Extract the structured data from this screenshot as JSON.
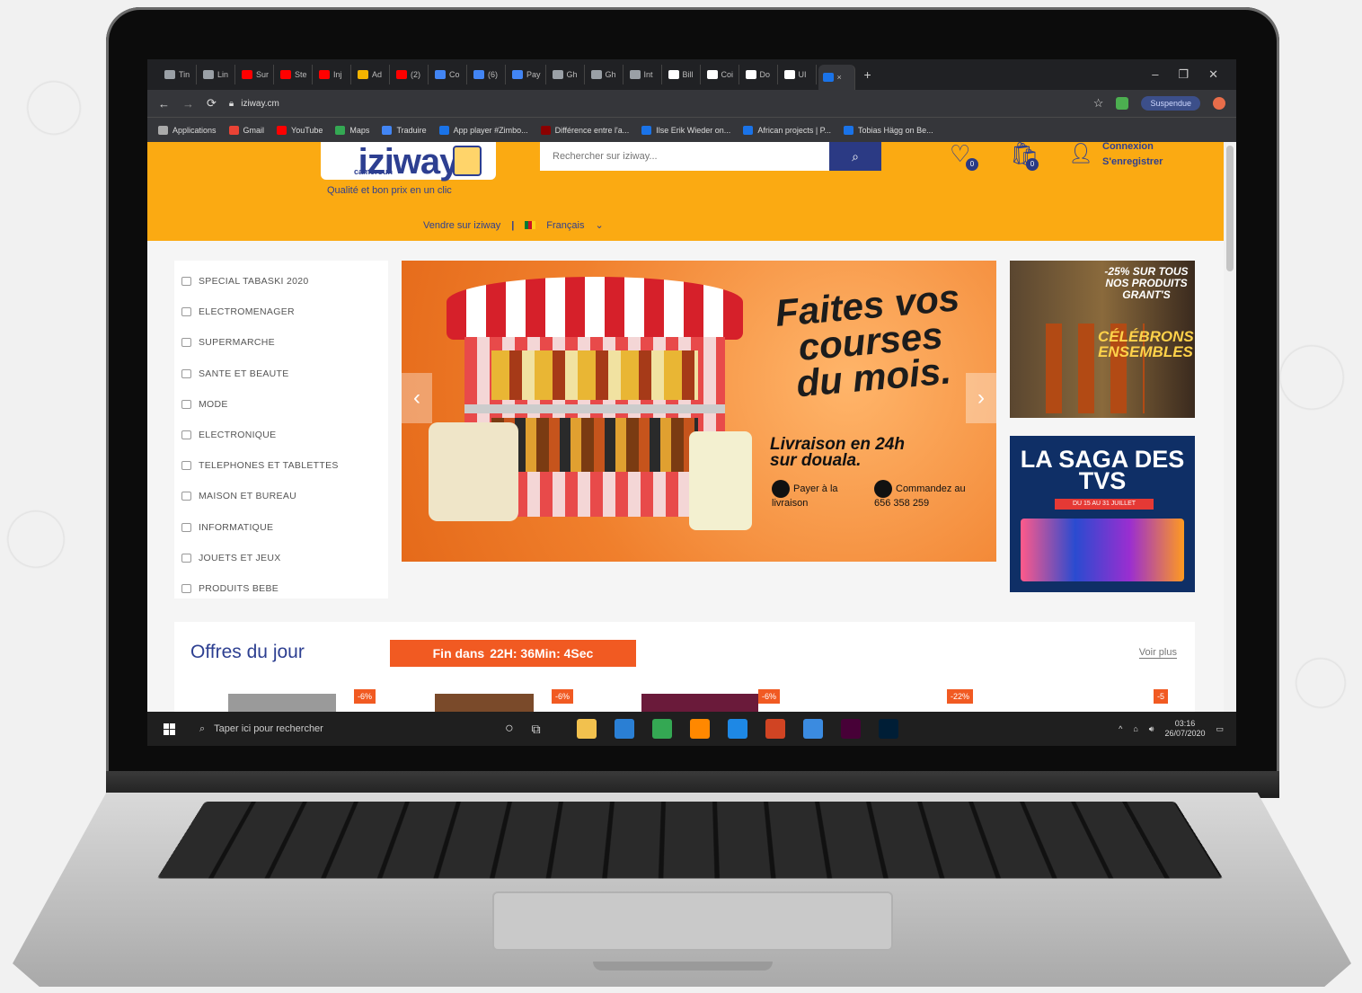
{
  "browser": {
    "tabs": [
      {
        "label": "Tin",
        "color": "#9aa0a6"
      },
      {
        "label": "Lin",
        "color": "#9aa0a6"
      },
      {
        "label": "Sur",
        "color": "#ff0000"
      },
      {
        "label": "Ste",
        "color": "#ff0000"
      },
      {
        "label": "Inj",
        "color": "#ff0000"
      },
      {
        "label": "Ad",
        "color": "#f4b400"
      },
      {
        "label": "(2)",
        "color": "#ff0000"
      },
      {
        "label": "Co",
        "color": "#4285f4"
      },
      {
        "label": "(6)",
        "color": "#4285f4"
      },
      {
        "label": "Pay",
        "color": "#4285f4"
      },
      {
        "label": "Gh",
        "color": "#9aa0a6"
      },
      {
        "label": "Gh",
        "color": "#9aa0a6"
      },
      {
        "label": "Int",
        "color": "#9aa0a6"
      },
      {
        "label": "Bill",
        "color": "#ffffff"
      },
      {
        "label": "Coi",
        "color": "#ffffff"
      },
      {
        "label": "Do",
        "color": "#ffffff"
      },
      {
        "label": "UI",
        "color": "#ffffff"
      }
    ],
    "active_tab_close": "×",
    "new_tab": "+",
    "window_controls": {
      "minimize": "–",
      "maximize": "❐",
      "close": "✕"
    },
    "url": "iziway.cm",
    "profile_button": "Suspendue",
    "bookmarks": [
      {
        "label": "Applications",
        "color": "#aaaaaa"
      },
      {
        "label": "Gmail",
        "color": "#ea4335"
      },
      {
        "label": "YouTube",
        "color": "#ff0000"
      },
      {
        "label": "Maps",
        "color": "#34a853"
      },
      {
        "label": "Traduire",
        "color": "#4285f4"
      },
      {
        "label": "App player #Zimbo...",
        "color": "#1a73e8"
      },
      {
        "label": "Différence entre l'a...",
        "color": "#8b0000"
      },
      {
        "label": "Ilse Erik Wieder on...",
        "color": "#1a73e8"
      },
      {
        "label": "African projects | P...",
        "color": "#1a73e8"
      },
      {
        "label": "Tobias Hägg on Be...",
        "color": "#1a73e8"
      }
    ]
  },
  "site": {
    "logo_text": "iziway",
    "logo_sub": "cameroun",
    "slogan": "Qualité et bon prix en un clic",
    "search_placeholder": "Rechercher sur iziway...",
    "wishlist_count": "0",
    "cart_count": "0",
    "login": "Connexion",
    "register": "S'enregistrer",
    "sell_link": "Vendre sur iziway",
    "language": "Français",
    "language_chevron": "⌄"
  },
  "categories": [
    "SPECIAL TABASKI 2020",
    "ELECTROMENAGER",
    "SUPERMARCHE",
    "SANTE ET BEAUTE",
    "MODE",
    "ELECTRONIQUE",
    "TELEPHONES ET TABLETTES",
    "MAISON ET BUREAU",
    "INFORMATIQUE",
    "JOUETS ET JEUX",
    "PRODUITS BEBE"
  ],
  "banner": {
    "title": "Faites vos courses du mois.",
    "subtitle_line1": "Livraison en 24h",
    "subtitle_line2": "sur douala.",
    "pay_label": "Payer à la livraison",
    "order_label": "Commandez au 656 358 259",
    "prev": "‹",
    "next": "›"
  },
  "ad1": {
    "promo": "-25% SUR TOUS NOS PRODUITS GRANT'S",
    "tagline": "CÉLÉBRONS ENSEMBLES"
  },
  "ad2": {
    "title": "LA SAGA DES TVS",
    "dates": "DU 15 AU 31 JUILLET"
  },
  "offers": {
    "title": "Offres du jour",
    "timer_prefix": "Fin dans",
    "timer_value": "22H: 36Min: 4Sec",
    "see_more": "Voir plus",
    "discounts": [
      "-6%",
      "-6%",
      "-6%",
      "-22%",
      "-5"
    ]
  },
  "taskbar": {
    "search_placeholder": "Taper ici pour rechercher",
    "apps": [
      {
        "name": "file-explorer",
        "color": "#f2c14e"
      },
      {
        "name": "mail",
        "color": "#2a7fd4"
      },
      {
        "name": "chrome",
        "color": "#34a853"
      },
      {
        "name": "vlc",
        "color": "#ff8800"
      },
      {
        "name": "edge",
        "color": "#1e88e5"
      },
      {
        "name": "powerpoint",
        "color": "#d04423"
      },
      {
        "name": "photos",
        "color": "#3b8be0"
      },
      {
        "name": "adobe-xd",
        "color": "#470137"
      },
      {
        "name": "photoshop",
        "color": "#001e36"
      }
    ],
    "time": "03:16",
    "date": "26/07/2020"
  },
  "colors": {
    "header_yellow": "#fbaa12",
    "brand_blue": "#2d3f91",
    "timer_orange": "#f15a22"
  }
}
